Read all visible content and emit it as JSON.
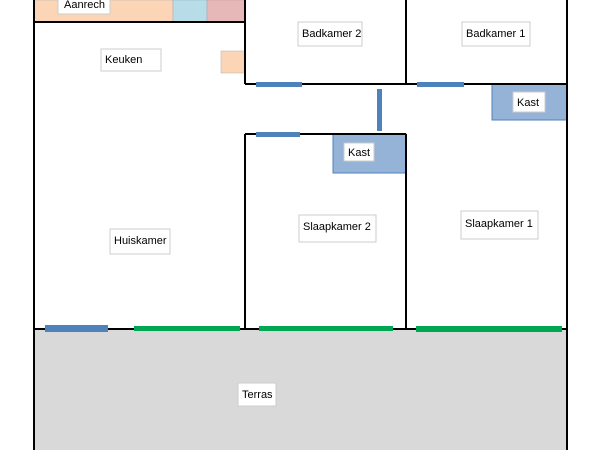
{
  "rooms": {
    "aanrecht": "Aanrech",
    "keuken": "Keuken",
    "badkamer2": "Badkamer 2",
    "badkamer1": "Badkamer 1",
    "kast_right": "Kast",
    "kast_mid": "Kast",
    "huiskamer": "Huiskamer",
    "slaapkamer2": "Slaapkamer 2",
    "slaapkamer1": "Slaapkamer 1",
    "terras": "Terras"
  },
  "colors": {
    "wall": "#000000",
    "counter": "#fbd5b5",
    "sink": "#b6dde8",
    "appliance": "#e6b9b8",
    "closet": "#95b3d7",
    "closet_border": "#4f81bd",
    "door": "#4f81bd",
    "window": "#00a651",
    "terrace": "#d9d9d9",
    "label_box_border": "#cccccc"
  }
}
